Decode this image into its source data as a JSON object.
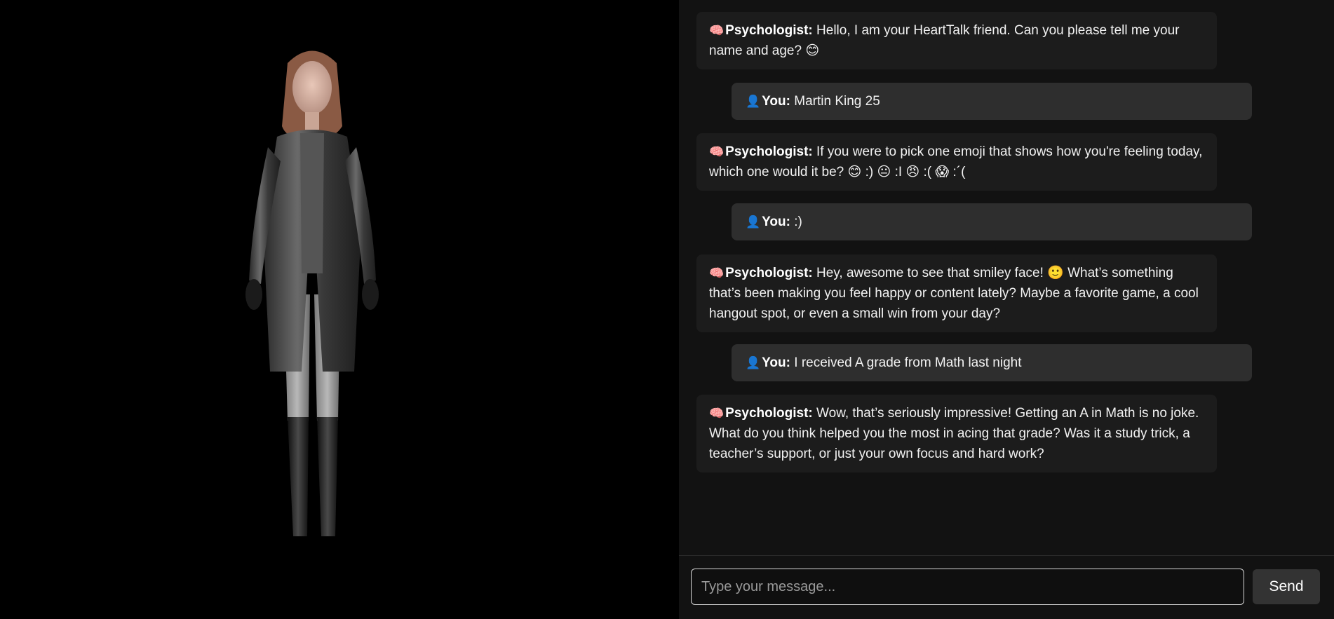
{
  "chat": {
    "messages": [
      {
        "role": "bot",
        "icon": "🧠",
        "speaker": "Psychologist:",
        "text": "Hello, I am your HeartTalk friend. Can you please tell me your name and age? 😊"
      },
      {
        "role": "user",
        "icon": "👤",
        "speaker": "You:",
        "text": "Martin King 25"
      },
      {
        "role": "bot",
        "icon": "🧠",
        "speaker": "Psychologist:",
        "text": "If you were to pick one emoji that shows how you're feeling today, which one would it be? 😊 :) 😐 :I 😠 :( 😱 :´("
      },
      {
        "role": "user",
        "icon": "👤",
        "speaker": "You:",
        "text": ":)"
      },
      {
        "role": "bot",
        "icon": "🧠",
        "speaker": "Psychologist:",
        "text": "Hey, awesome to see that smiley face! 🙂 What’s something that’s been making you feel happy or content lately? Maybe a favorite game, a cool hangout spot, or even a small win from your day?"
      },
      {
        "role": "user",
        "icon": "👤",
        "speaker": "You:",
        "text": "I received A grade from Math last night"
      },
      {
        "role": "bot",
        "icon": "🧠",
        "speaker": "Psychologist:",
        "text": "Wow, that’s seriously impressive! Getting an A in Math is no joke. What do you think helped you the most in acing that grade? Was it a study trick, a teacher’s support, or just your own focus and hard work?"
      }
    ]
  },
  "input": {
    "placeholder": "Type your message...",
    "value": ""
  },
  "send_button": {
    "label": "Send"
  },
  "colors": {
    "background": "#000000",
    "chat_background": "#121212",
    "bot_bubble": "#1c1c1c",
    "user_bubble": "#2e2e2e",
    "text": "#f2f2f2"
  }
}
